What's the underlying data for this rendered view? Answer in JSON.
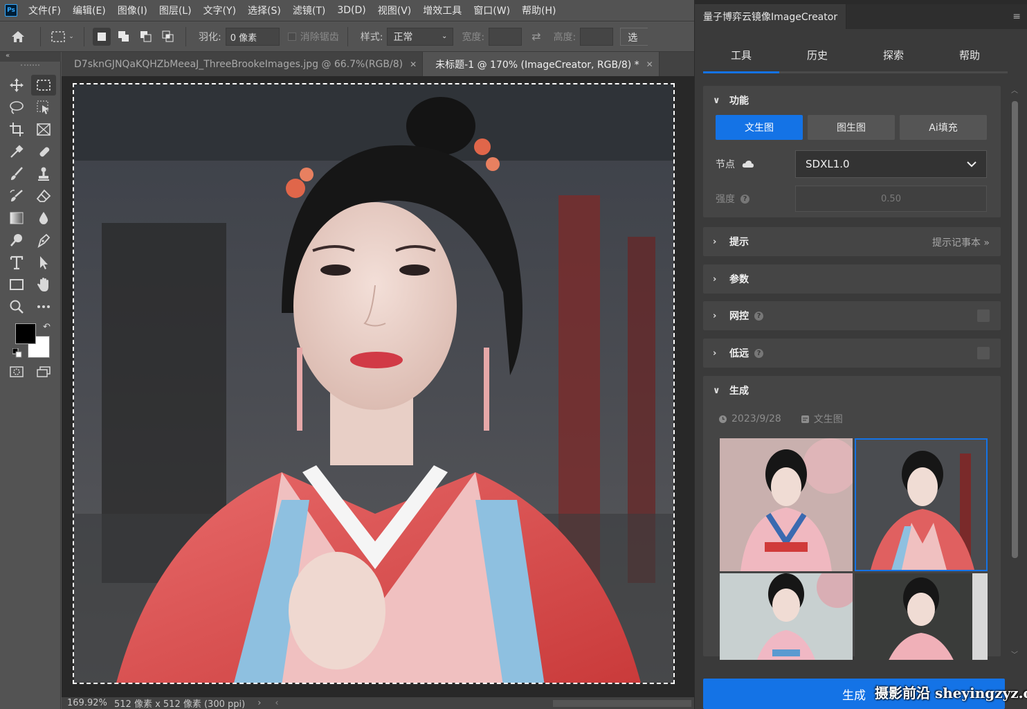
{
  "menubar": {
    "logo": "Ps",
    "items": [
      "文件(F)",
      "编辑(E)",
      "图像(I)",
      "图层(L)",
      "文字(Y)",
      "选择(S)",
      "滤镜(T)",
      "3D(D)",
      "视图(V)",
      "增效工具",
      "窗口(W)",
      "帮助(H)"
    ]
  },
  "options": {
    "feather_label": "羽化:",
    "feather_value": "0 像素",
    "antialias_label": "消除锯齿",
    "style_label": "样式:",
    "style_value": "正常",
    "width_label": "宽度:",
    "height_label": "高度:",
    "end_button": "选"
  },
  "toolbar": {
    "collapse": "«"
  },
  "doc_tabs": [
    {
      "title": "D7sknGJNQaKQHZbMeeaJ_ThreeBrookeImages.jpg @ 66.7%(RGB/8)",
      "active": false
    },
    {
      "title": "未标题-1 @ 170% (ImageCreator, RGB/8) *",
      "active": true
    }
  ],
  "status": {
    "zoom": "169.92%",
    "doc_size": "512 像素 x 512 像素 (300 ppi)",
    "arrow": "›",
    "scroll_left": "‹"
  },
  "panel": {
    "title": "量子博弈云镜像ImageCreator",
    "nav_tabs": [
      "工具",
      "历史",
      "探索",
      "帮助"
    ],
    "active_tab": 0,
    "sections": {
      "function": {
        "title": "功能",
        "buttons": [
          "文生图",
          "图生图",
          "Ai填充"
        ],
        "node_label": "节点",
        "node_value": "SDXL1.0",
        "strength_label": "强度",
        "strength_value": "0.50"
      },
      "prompt": {
        "title": "提示",
        "right": "提示记事本 »"
      },
      "params": {
        "title": "参数"
      },
      "controlnet": {
        "title": "网控"
      },
      "lowres": {
        "title": "低远"
      },
      "generate": {
        "title": "生成",
        "date": "2023/9/28",
        "mode": "文生图"
      }
    },
    "generate_button": "生成"
  },
  "colors": {
    "accent": "#1473e6",
    "foreground": "#000000",
    "background": "#ffffff"
  },
  "watermark": "摄影前沿 sheyingzyz.com"
}
